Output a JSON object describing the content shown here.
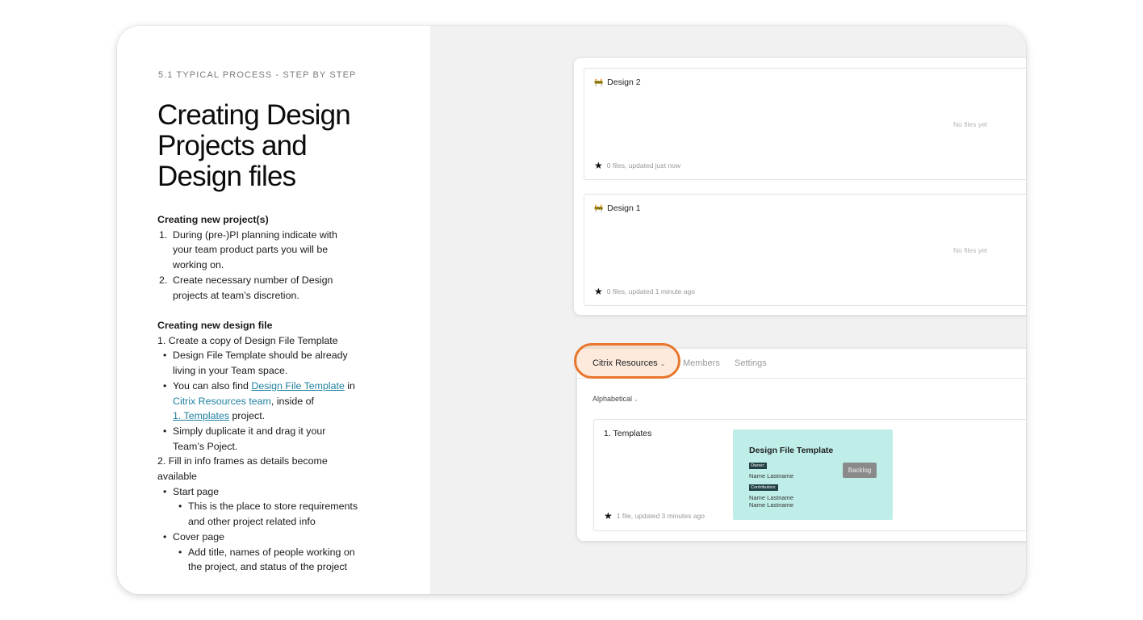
{
  "section_label": "5.1 TYPICAL PROCESS - STEP BY STEP",
  "title_lines": [
    "Creating Design",
    "Projects and",
    "Design files"
  ],
  "creating_project": {
    "heading": "Creating new project(s)",
    "items": [
      {
        "num": "1.",
        "lines": [
          "During (pre-)PI planning indicate with",
          "your team product parts you will be",
          "working on."
        ]
      },
      {
        "num": "2.",
        "lines": [
          "Create necessary number of Design",
          "projects at team’s discretion."
        ]
      }
    ]
  },
  "creating_file": {
    "heading": "Creating new design file",
    "step1": "1. Create a copy of Design File Template",
    "b1_lines": [
      "Design File Template should be already",
      "living in your Team space."
    ],
    "b2_prefix": "You can also find ",
    "b2_link1": "Design File Template",
    "b2_mid": " in",
    "b2_link2": "Citrix Resources team",
    "b2_mid2": ", inside of",
    "b2_link3": "1. Templates",
    "b2_suffix": " project.",
    "b3_lines": [
      "Simply duplicate it and drag it your",
      "Team’s Poject."
    ],
    "step2_lines": [
      "2. Fill in info frames as details become",
      "available"
    ],
    "start_page": "Start page",
    "start_sub_lines": [
      "This is the place to store requirements",
      "and other project related info"
    ],
    "cover_page": "Cover page",
    "cover_sub_lines": [
      "Add title, names of people working on",
      "the project, and status of the project"
    ],
    "bullet": "•"
  },
  "projects": [
    {
      "name": "Design 2",
      "empty_text": "No files yet",
      "meta": "0 files, updated just now"
    },
    {
      "name": "Design 1",
      "empty_text": "No files yet",
      "meta": "0 files, updated 1 minute ago"
    }
  ],
  "project_emoji": "🚧",
  "team_tabs": {
    "active": "Citrix Resources",
    "members": "Members",
    "settings": "Settings"
  },
  "sort_label": "Alphabetical",
  "templates_project": {
    "name": "1. Templates",
    "meta": "1 file, updated 3 minutes ago",
    "thumb_title": "Design File Template",
    "owner_tag": "Owner:",
    "owner_name": "Name Lastname",
    "contributors_tag": "Contributors:",
    "contributor_1": "Name Lastname",
    "contributor_2": "Name Lastname",
    "status": "Backlog"
  },
  "colors": {
    "highlight_ring": "#e8762c",
    "link": "#1e7fa0",
    "thumb_bg": "#bfeee9",
    "status_badge": "#8a8a8a"
  },
  "icons": {
    "star": "★",
    "chevron": "⌄"
  }
}
